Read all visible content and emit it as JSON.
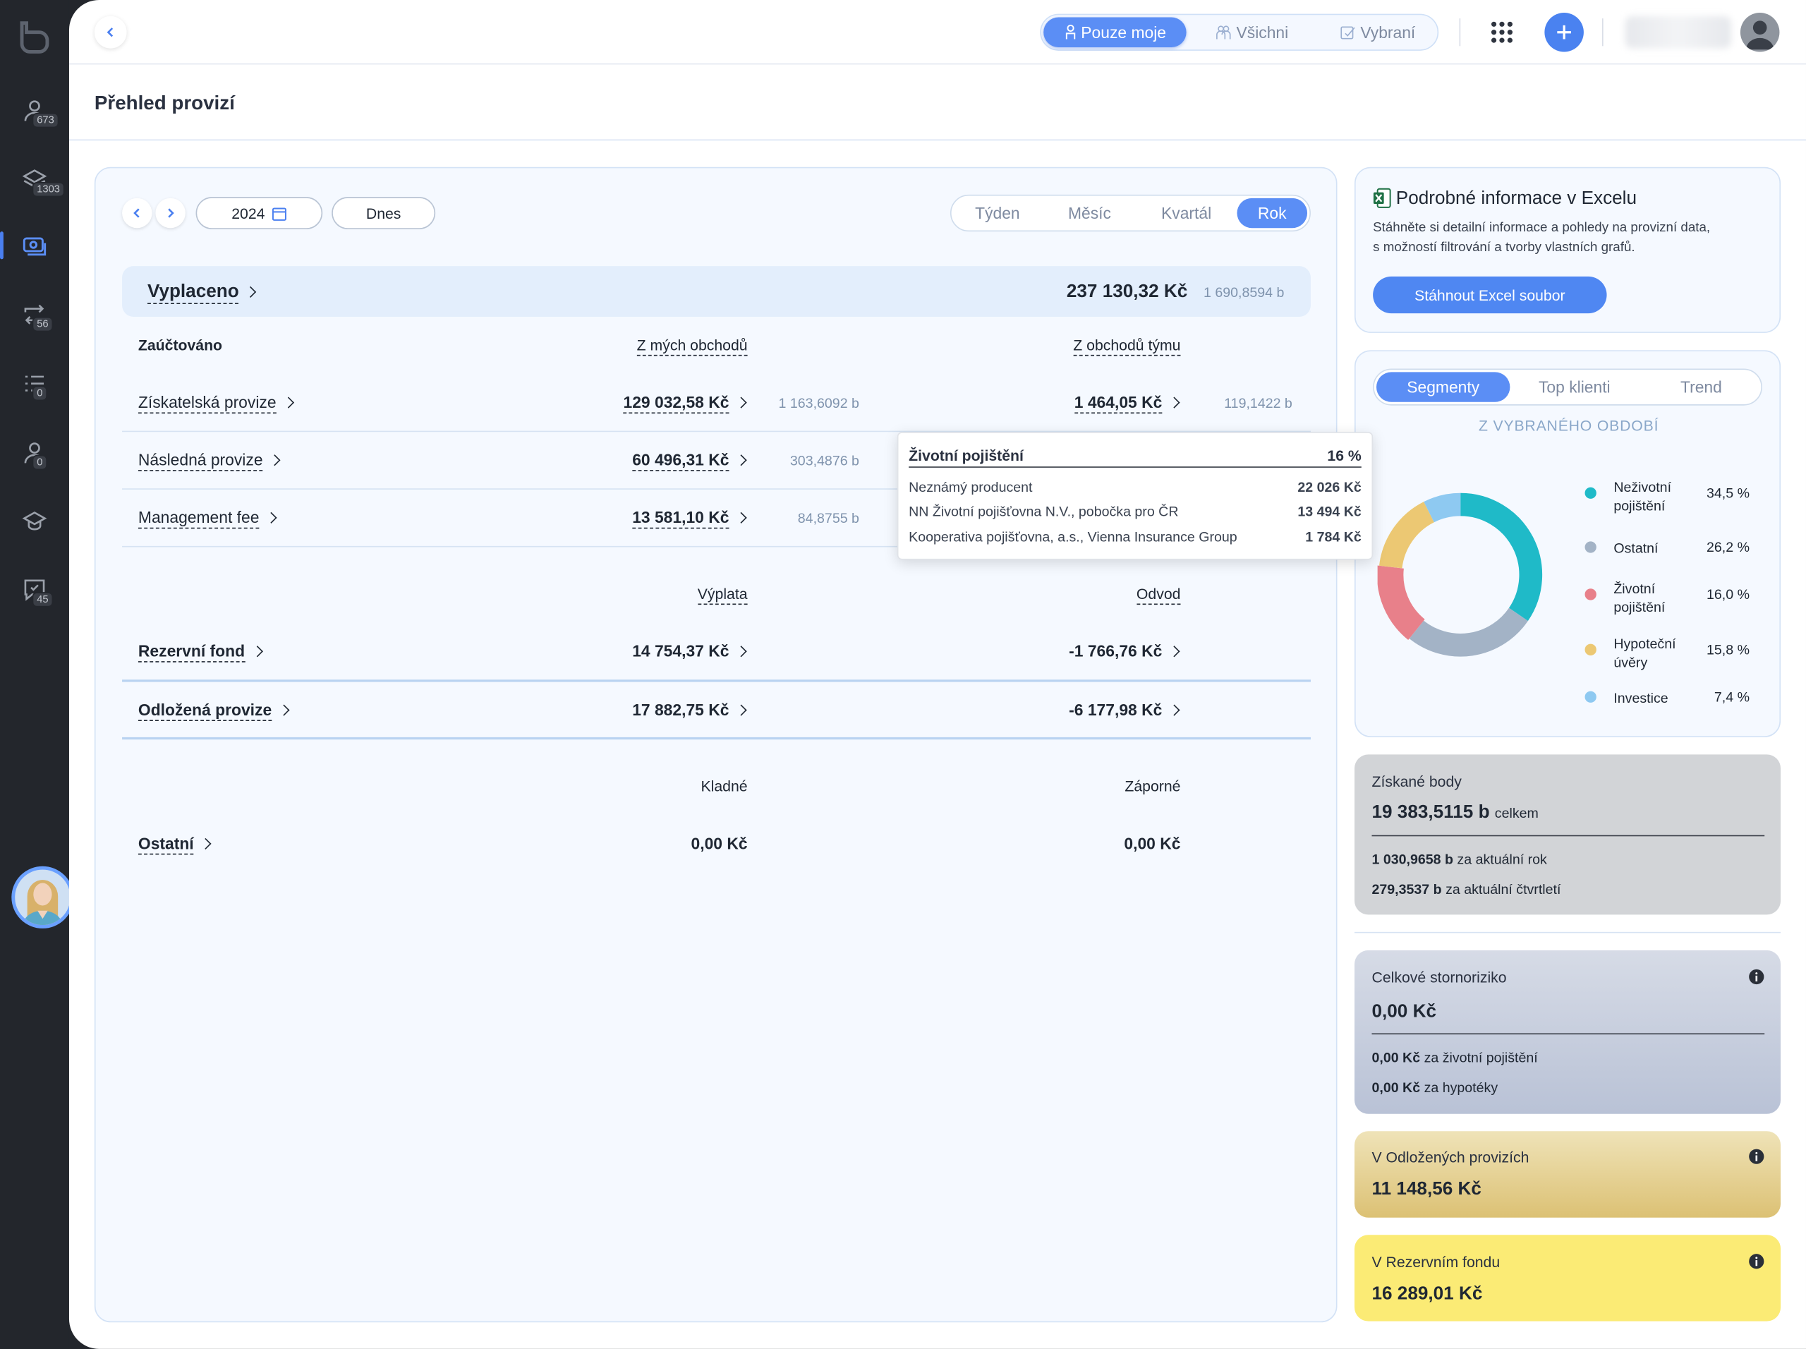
{
  "sidebar": {
    "badges": {
      "clients": "673",
      "contracts": "1303",
      "transfers": "56",
      "tasks": "0",
      "users": "0",
      "messages": "45"
    }
  },
  "topbar": {
    "scope": {
      "mine": "Pouze moje",
      "all": "Všichni",
      "selected": "Vybraní"
    }
  },
  "page": {
    "title": "Přehled provizí"
  },
  "filters": {
    "year": "2024",
    "today": "Dnes",
    "periods": [
      "Týden",
      "Měsíc",
      "Kvartál",
      "Rok"
    ],
    "active_period": "Rok"
  },
  "paid": {
    "label": "Vyplaceno",
    "amount": "237 130,32 Kč",
    "points": "1 690,8594 b"
  },
  "accounted": {
    "label": "Zaúčtováno",
    "col_mine": "Z mých obchodů",
    "col_team": "Z obchodů týmu",
    "rows": [
      {
        "label": "Získatelská provize",
        "mine": "129 032,58 Kč",
        "mine_points": "1 163,6092 b",
        "team": "1 464,05 Kč",
        "team_points": "119,1422 b"
      },
      {
        "label": "Následná provize",
        "mine": "60 496,31 Kč",
        "mine_points": "303,4876 b"
      },
      {
        "label": "Management fee",
        "mine": "13 581,10 Kč",
        "mine_points": "84,8755 b"
      }
    ]
  },
  "funds": {
    "col_payout": "Výplata",
    "col_levy": "Odvod",
    "rows": [
      {
        "label": "Rezervní fond",
        "payout": "14 754,37 Kč",
        "levy": "-1 766,76 Kč"
      },
      {
        "label": "Odložená provize",
        "payout": "17 882,75 Kč",
        "levy": "-6 177,98 Kč"
      }
    ]
  },
  "other": {
    "col_pos": "Kladné",
    "col_neg": "Záporné",
    "label": "Ostatní",
    "pos": "0,00 Kč",
    "neg": "0,00 Kč"
  },
  "tooltip": {
    "title": "Životní pojištění",
    "pct": "16 %",
    "rows": [
      {
        "name": "Neznámý producent",
        "value": "22 026 Kč"
      },
      {
        "name": "NN Životní pojišťovna N.V., pobočka pro ČR",
        "value": "13 494 Kč"
      },
      {
        "name": "Kooperativa pojišťovna, a.s., Vienna Insurance Group",
        "value": "1 784 Kč"
      }
    ]
  },
  "excel": {
    "title": "Podrobné informace v Excelu",
    "desc1": "Stáhněte si detailní informace a pohledy na provizní data,",
    "desc2": "s možností filtrování a tvorby vlastních grafů.",
    "button": "Stáhnout Excel soubor"
  },
  "segments": {
    "tabs": [
      "Segmenty",
      "Top klienti",
      "Trend"
    ],
    "subtitle": "Z VYBRANÉHO OBDOBÍ"
  },
  "chart_data": {
    "type": "pie",
    "variant": "donut",
    "legend": "right",
    "series": [
      {
        "name": "Neživotní pojištění",
        "value": 34.5,
        "label": "34,5 %",
        "color": "#1fbac8"
      },
      {
        "name": "Ostatní",
        "value": 26.2,
        "label": "26,2 %",
        "color": "#a3b3c6"
      },
      {
        "name": "Životní pojištění",
        "value": 16.0,
        "label": "16,0 %",
        "color": "#e8808a"
      },
      {
        "name": "Hypoteční úvěry",
        "value": 15.8,
        "label": "15,8 %",
        "color": "#ecc873"
      },
      {
        "name": "Investice",
        "value": 7.4,
        "label": "7,4 %",
        "color": "#8ec9f1"
      }
    ]
  },
  "points": {
    "title": "Získané body",
    "total": "19 383,5115 b",
    "total_suffix": "celkem",
    "year": "1 030,9658 b",
    "year_suffix": "za aktuální rok",
    "quarter": "279,3537 b",
    "quarter_suffix": "za aktuální čtvrtletí"
  },
  "storno": {
    "title": "Celkové stornoriziko",
    "total": "0,00 Kč",
    "life": "0,00 Kč",
    "life_suffix": "za životní pojištění",
    "mortgage": "0,00 Kč",
    "mortgage_suffix": "za hypotéky"
  },
  "deferred": {
    "title": "V Odložených provizích",
    "value": "11 148,56 Kč"
  },
  "reserve": {
    "title": "V Rezervním fondu",
    "value": "16 289,01 Kč"
  }
}
